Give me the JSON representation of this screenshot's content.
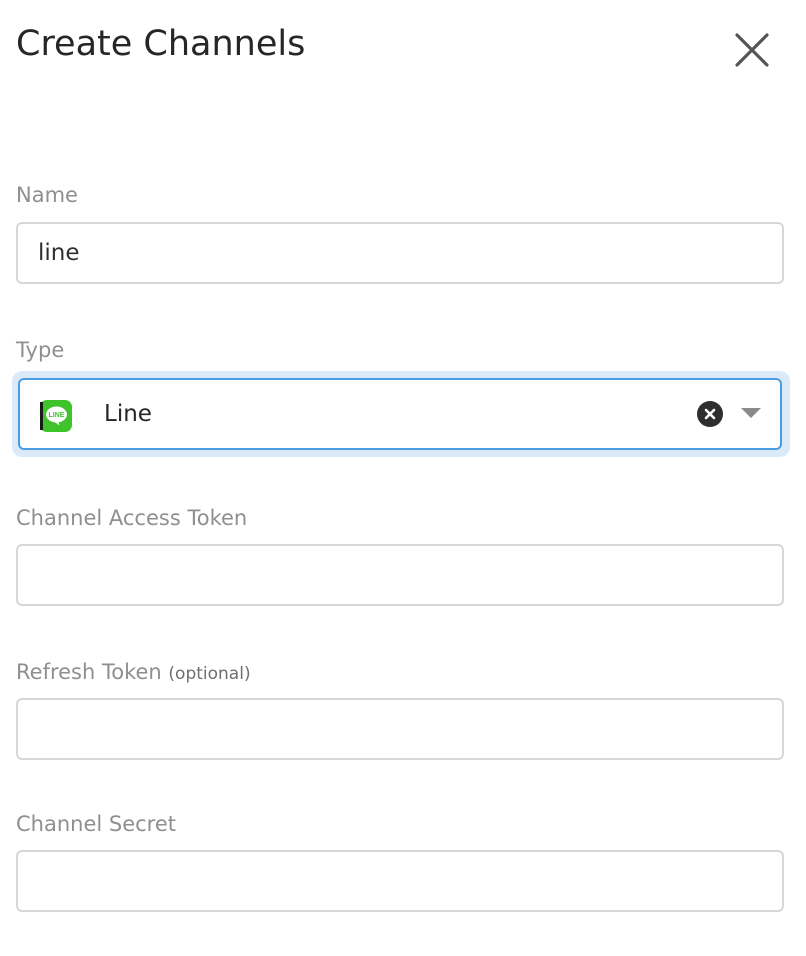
{
  "dialog": {
    "title": "Create Channels",
    "close_icon": "close-icon"
  },
  "form": {
    "name": {
      "label": "Name",
      "value": "line"
    },
    "type": {
      "label": "Type",
      "selected": "Line",
      "logo_icon": "line-logo-icon",
      "logo_text": "LINE",
      "clear_icon": "clear-icon",
      "arrow_icon": "chevron-down-icon"
    },
    "channel_access_token": {
      "label": "Channel Access Token",
      "value": ""
    },
    "refresh_token": {
      "label": "Refresh Token",
      "optional": "(optional)",
      "value": ""
    },
    "channel_secret": {
      "label": "Channel Secret",
      "value": ""
    }
  },
  "colors": {
    "focus_border": "#4a9de3",
    "focus_glow": "#dbeaf8",
    "line_green": "#3ec32a",
    "label_gray": "#8f8f8f",
    "input_border": "#d7d7d7"
  }
}
